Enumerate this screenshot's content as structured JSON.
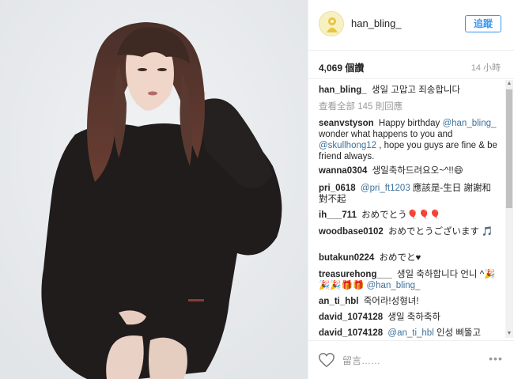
{
  "post": {
    "username": "han_bling_",
    "follow_label": "追蹤",
    "likes": "4,069 個讚",
    "time": "14 小時"
  },
  "caption": {
    "username": "han_bling_",
    "text": "생일 고맙고 죄송합니다",
    "view_all": "查看全部 145 則回應"
  },
  "comments": [
    {
      "user": "seanvstyson",
      "pre": "Happy birthday",
      "mention1": "@han_bling_",
      "mid": " wonder what happens to you and ",
      "mention2": "@skullhong12",
      "post": ", hope you guys are fine & be friend always."
    },
    {
      "user": "wanna0304",
      "text": "생일축하드려요오~^!!😄"
    },
    {
      "user": "pri_0618",
      "mention": "@pri_ft1203",
      "text": " 應該是-生日 謝謝和對不起"
    },
    {
      "user": "ih___711",
      "text": "おめでとう🎈🎈🎈"
    },
    {
      "user": "woodbase0102",
      "text": "おめでとうございます 🎵"
    },
    {
      "user": "butakun0224",
      "text": "おめでと♥"
    },
    {
      "user": "treasurehong___",
      "text": "생일 축하합니다 언니 ^🎉🎉🎉🎁🎁",
      "mention": "@han_bling_"
    },
    {
      "user": "an_ti_hbl",
      "text": "죽어라!성형녀!"
    },
    {
      "user": "david_1074128",
      "text": "생일 축하축하"
    },
    {
      "user": "david_1074128",
      "mention": "@an_ti_hbl",
      "text": " 인성 삐뚤고"
    }
  ],
  "footer": {
    "placeholder": "留言……"
  },
  "icons": {
    "heart": "heart-icon",
    "more": "more-options-icon"
  },
  "colors": {
    "accent": "#3897f0",
    "mention": "#3f729b"
  }
}
